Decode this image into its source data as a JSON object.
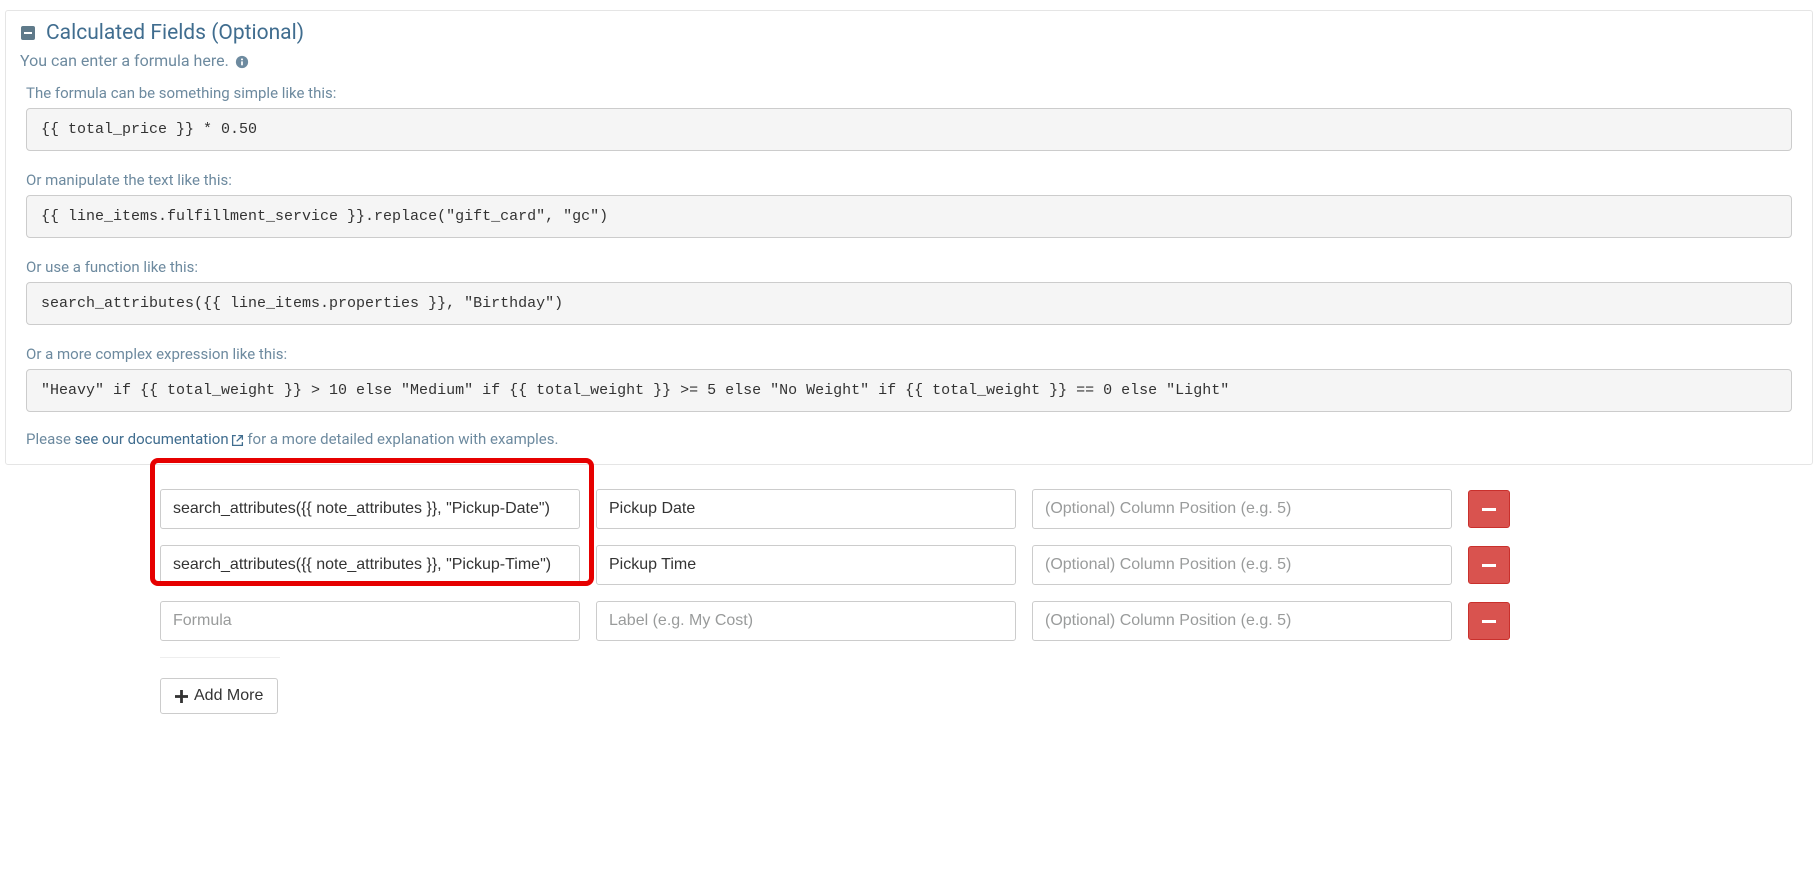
{
  "section": {
    "title": "Calculated Fields (Optional)",
    "subtitle": "You can enter a formula here."
  },
  "help": {
    "label1": "The formula can be something simple like this:",
    "code1": "{{ total_price }} * 0.50",
    "label2": "Or manipulate the text like this:",
    "code2": "{{ line_items.fulfillment_service }}.replace(\"gift_card\", \"gc\")",
    "label3": "Or use a function like this:",
    "code3": "search_attributes({{ line_items.properties }}, \"Birthday\")",
    "label4": "Or a more complex expression like this:",
    "code4": "\"Heavy\" if {{ total_weight }} > 10 else \"Medium\" if {{ total_weight }} >= 5 else \"No Weight\" if {{ total_weight }} == 0 else \"Light\"",
    "doc_prefix": "Please ",
    "doc_link": "see our documentation",
    "doc_suffix": " for a more detailed explanation with examples."
  },
  "placeholders": {
    "formula": "Formula",
    "label": "Label (e.g. My Cost)",
    "position": "(Optional) Column Position (e.g. 5)"
  },
  "rows": [
    {
      "formula": "search_attributes({{ note_attributes }}, \"Pickup-Date\")",
      "label": "Pickup Date",
      "position": ""
    },
    {
      "formula": "search_attributes({{ note_attributes }}, \"Pickup-Time\")",
      "label": "Pickup Time",
      "position": ""
    },
    {
      "formula": "",
      "label": "",
      "position": ""
    }
  ],
  "add_more_label": "Add More"
}
